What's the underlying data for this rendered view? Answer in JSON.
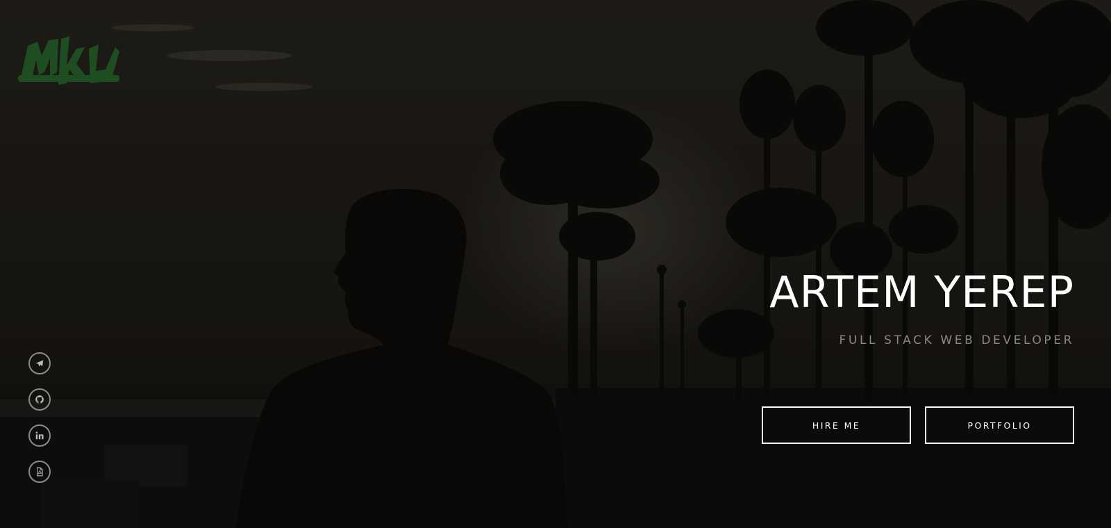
{
  "brand": {
    "logo_icon": "graffiti-logo-icon",
    "logo_color": "#1f4d22"
  },
  "social": [
    {
      "icon": "telegram-icon"
    },
    {
      "icon": "github-icon"
    },
    {
      "icon": "linkedin-icon"
    },
    {
      "icon": "pdf-resume-icon"
    }
  ],
  "hero": {
    "name": "ARTEM YEREP",
    "role": "FULL STACK WEB DEVELOPER"
  },
  "actions": {
    "hire_label": "HIRE ME",
    "portfolio_label": "PORTFOLIO"
  },
  "colors": {
    "text_primary": "#ffffff",
    "text_muted": "#8a8884",
    "icon_border": "#8e8c88"
  }
}
